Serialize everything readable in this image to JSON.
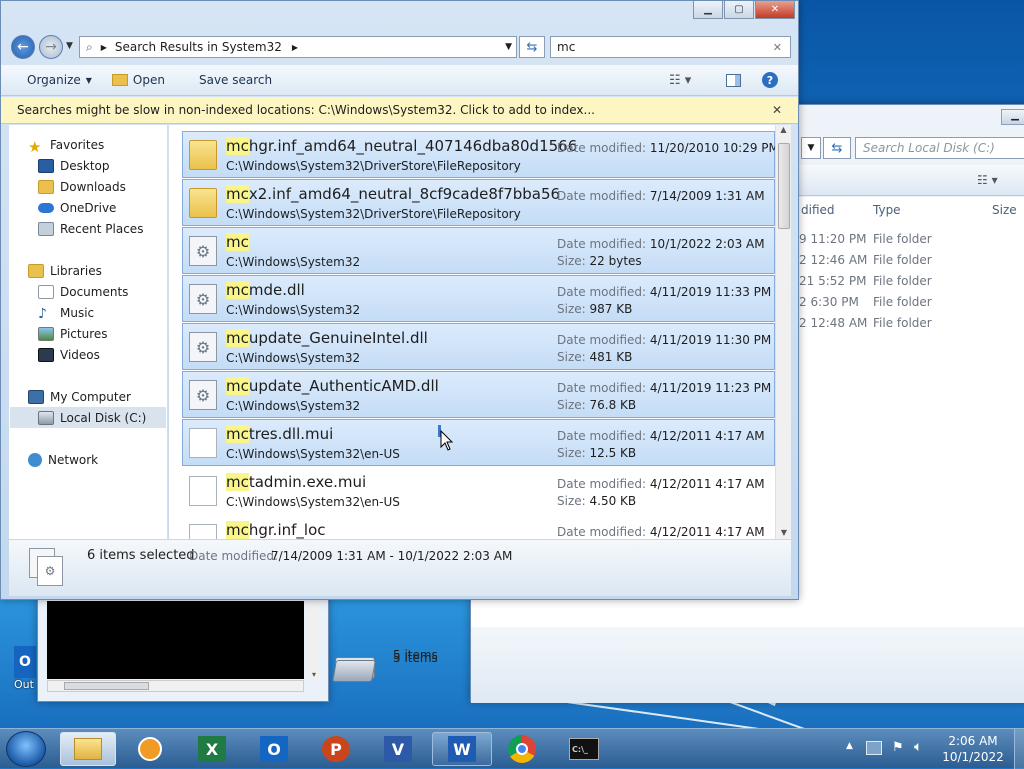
{
  "explorer": {
    "breadcrumb": "Search Results in System32",
    "search_value": "mc",
    "toolbar": {
      "organize": "Organize",
      "open": "Open",
      "save_search": "Save search"
    },
    "infobar": "Searches might be slow in non-indexed locations: C:\\Windows\\System32. Click to add to index...",
    "nav": {
      "favorites": "Favorites",
      "desktop": "Desktop",
      "downloads": "Downloads",
      "onedrive": "OneDrive",
      "recent": "Recent Places",
      "libraries": "Libraries",
      "documents": "Documents",
      "music": "Music",
      "pictures": "Pictures",
      "videos": "Videos",
      "computer": "My Computer",
      "localdisk": "Local Disk (C:)",
      "network": "Network"
    },
    "labels": {
      "date_modified": "Date modified:",
      "size": "Size:"
    },
    "results": [
      {
        "match": "mc",
        "rest": "hgr.inf_amd64_neutral_407146dba80d1566",
        "path": "C:\\Windows\\System32\\DriverStore\\FileRepository",
        "modified": "11/20/2010 10:29 PM",
        "size": "",
        "icon": "folder-icon",
        "selected": true
      },
      {
        "match": "mc",
        "rest": "x2.inf_amd64_neutral_8cf9cade8f7bba56",
        "path": "C:\\Windows\\System32\\DriverStore\\FileRepository",
        "modified": "7/14/2009 1:31 AM",
        "size": "",
        "icon": "folder-icon",
        "selected": true
      },
      {
        "match": "mc",
        "rest": "",
        "path": "C:\\Windows\\System32",
        "modified": "10/1/2022 2:03 AM",
        "size": "22 bytes",
        "icon": "system-file-icon",
        "selected": true
      },
      {
        "match": "mc",
        "rest": "mde.dll",
        "path": "C:\\Windows\\System32",
        "modified": "4/11/2019 11:33 PM",
        "size": "987 KB",
        "icon": "dll-icon",
        "selected": true
      },
      {
        "match": "mc",
        "rest": "update_GenuineIntel.dll",
        "path": "C:\\Windows\\System32",
        "modified": "4/11/2019 11:30 PM",
        "size": "481 KB",
        "icon": "dll-icon",
        "selected": true
      },
      {
        "match": "mc",
        "rest": "update_AuthenticAMD.dll",
        "path": "C:\\Windows\\System32",
        "modified": "4/11/2019 11:23 PM",
        "size": "76.8 KB",
        "icon": "dll-icon",
        "selected": true
      },
      {
        "match": "mc",
        "rest": "tres.dll.mui",
        "path": "C:\\Windows\\System32\\en-US",
        "modified": "4/12/2011 4:17 AM",
        "size": "12.5 KB",
        "icon": "document-icon",
        "selected": true
      },
      {
        "match": "mc",
        "rest": "tadmin.exe.mui",
        "path": "C:\\Windows\\System32\\en-US",
        "modified": "4/12/2011 4:17 AM",
        "size": "4.50 KB",
        "icon": "document-icon",
        "selected": false
      },
      {
        "match": "mc",
        "rest": "hgr.inf_loc",
        "path": "",
        "modified": "4/12/2011 4:17 AM",
        "size": "",
        "icon": "document-icon",
        "selected": false
      }
    ],
    "details": {
      "count": "6 items selected",
      "modified_label": "Date modified:",
      "modified_range": "7/14/2009 1:31 AM - 10/1/2022 2:03 AM"
    }
  },
  "background_window": {
    "search_placeholder": "Search Local Disk (C:)",
    "col_modified": "dified",
    "col_type": "Type",
    "col_size": "Size",
    "rows": [
      {
        "date": "9 11:20 PM",
        "type": "File folder"
      },
      {
        "date": "2 12:46 AM",
        "type": "File folder"
      },
      {
        "date": "21 5:52 PM",
        "type": "File folder"
      },
      {
        "date": "2 6:30 PM",
        "type": "File folder"
      },
      {
        "date": "2 12:48 AM",
        "type": "File folder"
      }
    ],
    "status": "5 items"
  },
  "desktop_icon_label": "Out",
  "taskbar": {
    "time": "2:06 AM",
    "date": "10/1/2022"
  },
  "colors": {
    "selection": "#cfe3fa",
    "highlight": "#f9f58a",
    "taskbar": "#3b6ea3"
  }
}
